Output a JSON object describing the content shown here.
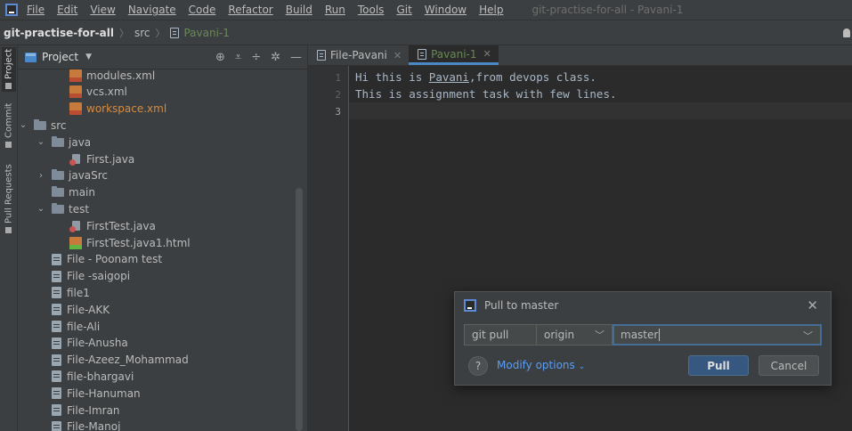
{
  "menu": {
    "items": [
      "File",
      "Edit",
      "View",
      "Navigate",
      "Code",
      "Refactor",
      "Build",
      "Run",
      "Tools",
      "Git",
      "Window",
      "Help"
    ],
    "window_title": "git-practise-for-all - Pavani-1"
  },
  "navbar": {
    "project": "git-practise-for-all",
    "folder": "src",
    "file": "Pavani-1"
  },
  "stripe": {
    "project": "Project",
    "commit": "Commit",
    "pull_requests": "Pull Requests"
  },
  "project_panel": {
    "title": "Project",
    "tree": [
      {
        "label": "modules.xml",
        "icon": "xml-file-icon",
        "indent": 2
      },
      {
        "label": "vcs.xml",
        "icon": "xml-file-icon",
        "indent": 2
      },
      {
        "label": "workspace.xml",
        "icon": "xml-file-icon",
        "indent": 2,
        "highlight": true
      },
      {
        "label": "src",
        "icon": "folder-icon",
        "indent": 0,
        "chevron": "open"
      },
      {
        "label": "java",
        "icon": "folder-icon",
        "indent": 1,
        "chevron": "open"
      },
      {
        "label": "First.java",
        "icon": "java-file-icon",
        "indent": 2
      },
      {
        "label": "javaSrc",
        "icon": "folder-icon",
        "indent": 1,
        "chevron": "closed"
      },
      {
        "label": "main",
        "icon": "folder-icon",
        "indent": 1
      },
      {
        "label": "test",
        "icon": "folder-icon",
        "indent": 1,
        "chevron": "open"
      },
      {
        "label": "FirstTest.java",
        "icon": "java-file-icon",
        "indent": 2
      },
      {
        "label": "FirstTest.java1.html",
        "icon": "html-file-icon",
        "indent": 2
      },
      {
        "label": "File - Poonam test",
        "icon": "text-file-icon",
        "indent": 1
      },
      {
        "label": "File -saigopi",
        "icon": "text-file-icon",
        "indent": 1
      },
      {
        "label": "file1",
        "icon": "text-file-icon",
        "indent": 1
      },
      {
        "label": "File-AKK",
        "icon": "text-file-icon",
        "indent": 1
      },
      {
        "label": "file-Ali",
        "icon": "text-file-icon",
        "indent": 1
      },
      {
        "label": "File-Anusha",
        "icon": "text-file-icon",
        "indent": 1
      },
      {
        "label": "File-Azeez_Mohammad",
        "icon": "text-file-icon",
        "indent": 1
      },
      {
        "label": "file-bhargavi",
        "icon": "text-file-icon",
        "indent": 1
      },
      {
        "label": "File-Hanuman",
        "icon": "text-file-icon",
        "indent": 1
      },
      {
        "label": "File-Imran",
        "icon": "text-file-icon",
        "indent": 1
      },
      {
        "label": "File-Manoj",
        "icon": "text-file-icon",
        "indent": 1
      }
    ]
  },
  "editor": {
    "tabs": [
      {
        "label": "File-Pavani",
        "active": false
      },
      {
        "label": "Pavani-1",
        "active": true
      }
    ],
    "lines": [
      {
        "number": "1",
        "text_before": "Hi this is ",
        "typo": "Pavani",
        "text_after": ",from devops class."
      },
      {
        "number": "2",
        "text_before": "This is assignment task with few lines.",
        "typo": "",
        "text_after": ""
      },
      {
        "number": "3",
        "text_before": "",
        "typo": "",
        "text_after": ""
      }
    ]
  },
  "dialog": {
    "title": "Pull to master",
    "command": "git pull",
    "remote": "origin",
    "branch": "master",
    "help": "?",
    "modify_options": "Modify options",
    "pull_label": "Pull",
    "cancel_label": "Cancel"
  },
  "colors": {
    "accent": "#4a88c7",
    "primary_button": "#365880",
    "link": "#589df6",
    "modified_file": "#6a8759",
    "ignored_file": "#d88b3c"
  }
}
